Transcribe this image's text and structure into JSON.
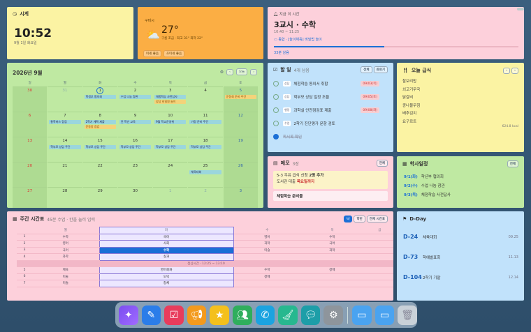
{
  "clock": {
    "title": "시계",
    "time": "10:52",
    "date": "9월 1일 화요일"
  },
  "weather": {
    "location": "구미시",
    "temp": "27°",
    "desc": "구름 조금 · 최고 31° 최저 22°",
    "chips": [
      "미세 좋음",
      "초미세 좋음"
    ]
  },
  "schedule": {
    "label": "지금 이 시간",
    "current": "3교시 · 수학",
    "range": "10:40 ~ 11:25",
    "task": "동합 · [놀이체육] 비밀법 놀이",
    "remaining": "33분 남음",
    "progress": 0.45
  },
  "calendar": {
    "title": "2026년 9월",
    "today_btn": "오늘",
    "dow": [
      "일",
      "월",
      "화",
      "수",
      "목",
      "금",
      "토"
    ],
    "weeks": [
      [
        {
          "n": "30",
          "o": true
        },
        {
          "n": "31",
          "o": true
        },
        {
          "n": "1",
          "today": true,
          "ev": [
            [
              "b",
              "학생부 협의회"
            ]
          ]
        },
        {
          "n": "2",
          "ev": [
            [
              "b",
              "수업 나눔 참관"
            ]
          ]
        },
        {
          "n": "3",
          "ev": [
            [
              "b",
              "체험학습 사전답사"
            ],
            [
              "y",
              "강당 비밀원 놀이"
            ]
          ]
        },
        {
          "n": "4"
        },
        {
          "n": "5",
          "ev": [
            [
              "y",
              "운동회 준비 주간"
            ]
          ]
        }
      ],
      [
        {
          "n": "6"
        },
        {
          "n": "7"
        },
        {
          "n": "8"
        },
        {
          "n": "9"
        },
        {
          "n": "10"
        },
        {
          "n": "11"
        },
        {
          "n": "12"
        }
      ],
      [
        {
          "n": "13"
        },
        {
          "n": "14",
          "ev": [
            [
              "b",
              "학부모 상담 주간"
            ]
          ]
        },
        {
          "n": "15",
          "ev": [
            [
              "b",
              "학부모 상담 주간"
            ]
          ]
        },
        {
          "n": "16",
          "ev": [
            [
              "b",
              "학부모 상담 주간"
            ]
          ]
        },
        {
          "n": "17",
          "ev": [
            [
              "b",
              "학부모 상담 주간"
            ]
          ]
        },
        {
          "n": "18",
          "ev": [
            [
              "b",
              "학부모 상담 주간"
            ]
          ]
        },
        {
          "n": "19"
        }
      ],
      [
        {
          "n": "20"
        },
        {
          "n": "21"
        },
        {
          "n": "22"
        },
        {
          "n": "23"
        },
        {
          "n": "24"
        },
        {
          "n": "25",
          "ev": [
            [
              "b",
              "체육대회"
            ]
          ]
        },
        {
          "n": "26"
        }
      ],
      [
        {
          "n": "27"
        },
        {
          "n": "28"
        },
        {
          "n": "29"
        },
        {
          "n": "30"
        },
        {
          "n": "1",
          "o": true
        },
        {
          "n": "2",
          "o": true
        },
        {
          "n": "3",
          "o": true
        }
      ]
    ],
    "extra": {
      "w1_mon": "개학식",
      "w2_mon": "통학버스 점검",
      "w2_tue": "2학기 계획 제출",
      "w2_tue2": "운동장 점검",
      "w2_wed": "전 학년 교육",
      "w2_thu": "9월 학교운영위",
      "w2_fri": "가정 준비 주간",
      "w2_sat": ""
    }
  },
  "todo": {
    "title": "할 일",
    "count": "4개 남음",
    "btns": [
      "전체",
      "완료기"
    ],
    "items": [
      {
        "tag": "상담",
        "text": "체험학습 동의서 취합",
        "due": "09/03(목)",
        "done": false
      },
      {
        "tag": "상담",
        "text": "학부모 상담 일정 조율",
        "due": "09/05(토)",
        "done": false
      },
      {
        "tag": "행정",
        "text": "과학실 안전점검표 제출",
        "due": "09/08(화)",
        "done": false
      },
      {
        "tag": "수업",
        "text": "2학기 진단평가 문항 검토",
        "due": "",
        "done": false
      },
      {
        "tag": "",
        "text": "독서록 확인",
        "due": "",
        "done": true
      }
    ]
  },
  "memo": {
    "title": "메모",
    "count": "3장",
    "btn": "전체",
    "note1a": "5-3 우유 급식 신청",
    "note1b": "2명 추가",
    "note1c": "도서관 대출",
    "note1d": "목요일까지",
    "note2": "체험학습 준비물"
  },
  "lunch": {
    "title": "오늘 급식",
    "items": [
      "찰보리밥",
      "쇠고기무국",
      "닭갈비",
      "콩나물무침",
      "배추김치",
      "요구르트"
    ],
    "kcal": "624.8 kcal"
  },
  "academic": {
    "title": "학사일정",
    "btn": "전체",
    "items": [
      {
        "d": "9/1(화)",
        "t": "학년부 협의회"
      },
      {
        "d": "9/2(수)",
        "t": "수업 나눔 참관"
      },
      {
        "d": "9/3(목)",
        "t": "체험학습 사전답사"
      }
    ]
  },
  "timetable": {
    "title": "주간 시간표",
    "sub": "45분 수업 · 칸을 눌러 입력",
    "btns": [
      "나",
      "학반",
      "전체 시간표"
    ],
    "head": [
      "",
      "월",
      "화",
      "수",
      "목",
      "금"
    ],
    "rows": [
      [
        "1",
        "수학",
        "국어",
        "영어",
        "수학",
        ""
      ],
      [
        "2",
        "영어",
        "사회",
        "과학",
        "국어",
        ""
      ],
      [
        "3",
        "국어",
        "수학",
        "미술",
        "과학",
        ""
      ],
      [
        "4",
        "과학",
        "실과",
        "",
        "",
        ""
      ]
    ],
    "lunch": "점심시간 · 12:25 ~ 13:10",
    "rows2": [
      [
        "5",
        "체육",
        "영어회화",
        "수학",
        "창체",
        ""
      ],
      [
        "6",
        "미술",
        "도덕",
        "창체",
        "",
        ""
      ],
      [
        "7",
        "미술",
        "창체",
        "",
        "",
        ""
      ]
    ]
  },
  "dday": {
    "title": "D-Day",
    "items": [
      {
        "d": "D-24",
        "t": "체육대회",
        "dt": "09.25"
      },
      {
        "d": "D-73",
        "t": "학예발표회",
        "dt": "11.13"
      },
      {
        "d": "D-104",
        "t": "2학기 기말",
        "dt": "12.14"
      }
    ]
  }
}
